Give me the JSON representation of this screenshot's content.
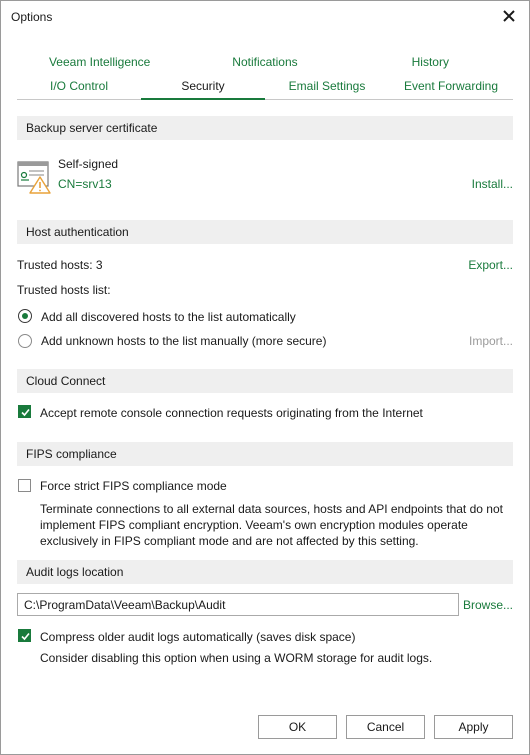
{
  "window": {
    "title": "Options"
  },
  "tabs": {
    "row1": [
      "Veeam Intelligence",
      "Notifications",
      "History"
    ],
    "row2": [
      "I/O Control",
      "Security",
      "Email Settings",
      "Event Forwarding"
    ],
    "active": "Security"
  },
  "certificate": {
    "header": "Backup server certificate",
    "type": "Self-signed",
    "cn": "CN=srv13",
    "install_label": "Install..."
  },
  "host_auth": {
    "header": "Host authentication",
    "trusted_hosts": "Trusted hosts: 3",
    "export_label": "Export...",
    "list_label": "Trusted hosts list:",
    "option_auto": "Add all discovered hosts to the list automatically",
    "option_manual": "Add unknown hosts to the list manually (more secure)",
    "import_label": "Import...",
    "selected": "auto"
  },
  "cloud_connect": {
    "header": "Cloud Connect",
    "accept_label": "Accept remote console connection requests originating from the Internet",
    "accept_checked": true
  },
  "fips": {
    "header": "FIPS compliance",
    "force_label": "Force strict FIPS compliance mode",
    "force_checked": false,
    "description": "Terminate connections to all external data sources, hosts and API endpoints that do not implement FIPS compliant encryption. Veeam's own encryption modules operate exclusively in FIPS compliant mode and are not affected by this setting."
  },
  "audit": {
    "header": "Audit logs location",
    "path": "C:\\ProgramData\\Veeam\\Backup\\Audit",
    "browse_label": "Browse...",
    "compress_label": "Compress older audit logs automatically (saves disk space)",
    "compress_checked": true,
    "hint": "Consider disabling this option when using a WORM storage for audit logs."
  },
  "buttons": {
    "ok": "OK",
    "cancel": "Cancel",
    "apply": "Apply"
  },
  "colors": {
    "accent": "#197a3c",
    "section_bg": "#efefef",
    "warning": "#e8a23a"
  },
  "icons": {
    "close": "close-icon",
    "certificate": "certificate-warning-icon",
    "check": "checkmark-icon"
  }
}
